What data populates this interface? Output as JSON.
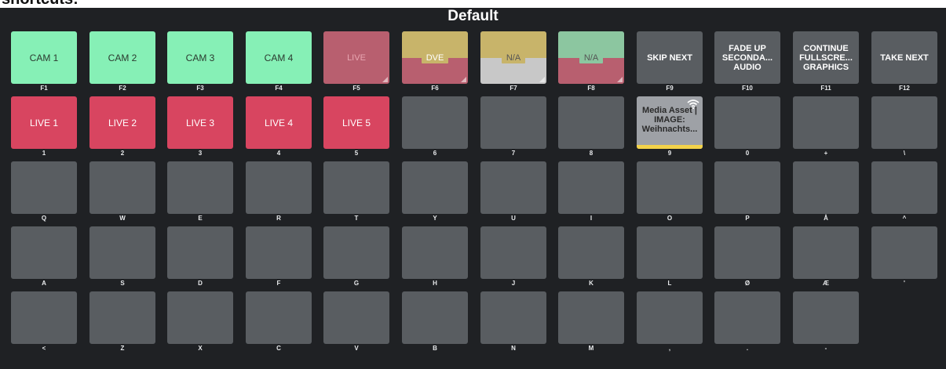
{
  "top_strip_text": "shortcuts:",
  "title": "Default",
  "icons": {
    "wifi": "wifi-icon",
    "corner": "corner-indicator-icon"
  },
  "colors": {
    "green": "#86f0b6",
    "red": "#d84560",
    "gold": "#c8b46a",
    "teal": "#8cc6a0",
    "gray_light": "#c8c8c8",
    "media_bar": "#f2d24a"
  },
  "rows": [
    [
      {
        "label": "CAM 1",
        "key": "F1",
        "style": "green"
      },
      {
        "label": "CAM 2",
        "key": "F2",
        "style": "green"
      },
      {
        "label": "CAM 3",
        "key": "F3",
        "style": "green"
      },
      {
        "label": "CAM 4",
        "key": "F4",
        "style": "green"
      },
      {
        "label": "LIVE",
        "key": "F5",
        "style": "dim-red",
        "corner": true
      },
      {
        "label": "DVE",
        "key": "F6",
        "style": "split",
        "top": "#c8b46a",
        "bottom": "#b85f6f",
        "chip": "#c8b46a",
        "textColor": "#ffffff",
        "corner": true
      },
      {
        "label": "N/A",
        "key": "F7",
        "style": "split",
        "top": "#c8b46a",
        "bottom": "#c8c8c8",
        "chip": "#c8b46a",
        "textColor": "#555555",
        "corner": true
      },
      {
        "label": "N/A",
        "key": "F8",
        "style": "split",
        "top": "#8cc6a0",
        "bottom": "#b85f6f",
        "chip": "#8cc6a0",
        "textColor": "#555555",
        "corner": true
      },
      {
        "label": "SKIP NEXT",
        "key": "F9"
      },
      {
        "label": "FADE UP\nSECONDA...\nAUDIO",
        "key": "F10"
      },
      {
        "label": "CONTINUE\nFULLSCRE...\nGRAPHICS",
        "key": "F11"
      },
      {
        "label": "TAKE NEXT",
        "key": "F12"
      }
    ],
    [
      {
        "label": "LIVE 1",
        "key": "1",
        "style": "red"
      },
      {
        "label": "LIVE 2",
        "key": "2",
        "style": "red"
      },
      {
        "label": "LIVE 3",
        "key": "3",
        "style": "red"
      },
      {
        "label": "LIVE 4",
        "key": "4",
        "style": "red"
      },
      {
        "label": "LIVE 5",
        "key": "5",
        "style": "red"
      },
      {
        "label": "",
        "key": "6"
      },
      {
        "label": "",
        "key": "7"
      },
      {
        "label": "",
        "key": "8"
      },
      {
        "label": "Media Asset |\nIMAGE:\nWeihnachts...",
        "key": "9",
        "style": "media"
      },
      {
        "label": "",
        "key": "0"
      },
      {
        "label": "",
        "key": "+"
      },
      {
        "label": "",
        "key": "\\"
      }
    ],
    [
      {
        "label": "",
        "key": "Q"
      },
      {
        "label": "",
        "key": "W"
      },
      {
        "label": "",
        "key": "E"
      },
      {
        "label": "",
        "key": "R"
      },
      {
        "label": "",
        "key": "T"
      },
      {
        "label": "",
        "key": "Y"
      },
      {
        "label": "",
        "key": "U"
      },
      {
        "label": "",
        "key": "I"
      },
      {
        "label": "",
        "key": "O"
      },
      {
        "label": "",
        "key": "P"
      },
      {
        "label": "",
        "key": "Å"
      },
      {
        "label": "",
        "key": "^"
      }
    ],
    [
      {
        "label": "",
        "key": "A"
      },
      {
        "label": "",
        "key": "S"
      },
      {
        "label": "",
        "key": "D"
      },
      {
        "label": "",
        "key": "F"
      },
      {
        "label": "",
        "key": "G"
      },
      {
        "label": "",
        "key": "H"
      },
      {
        "label": "",
        "key": "J"
      },
      {
        "label": "",
        "key": "K"
      },
      {
        "label": "",
        "key": "L"
      },
      {
        "label": "",
        "key": "Ø"
      },
      {
        "label": "",
        "key": "Æ"
      },
      {
        "label": "",
        "key": "'"
      }
    ],
    [
      {
        "label": "",
        "key": "<"
      },
      {
        "label": "",
        "key": "Z"
      },
      {
        "label": "",
        "key": "X"
      },
      {
        "label": "",
        "key": "C"
      },
      {
        "label": "",
        "key": "V"
      },
      {
        "label": "",
        "key": "B"
      },
      {
        "label": "",
        "key": "N"
      },
      {
        "label": "",
        "key": "M"
      },
      {
        "label": "",
        "key": ","
      },
      {
        "label": "",
        "key": "."
      },
      {
        "label": "",
        "key": "-"
      }
    ]
  ]
}
